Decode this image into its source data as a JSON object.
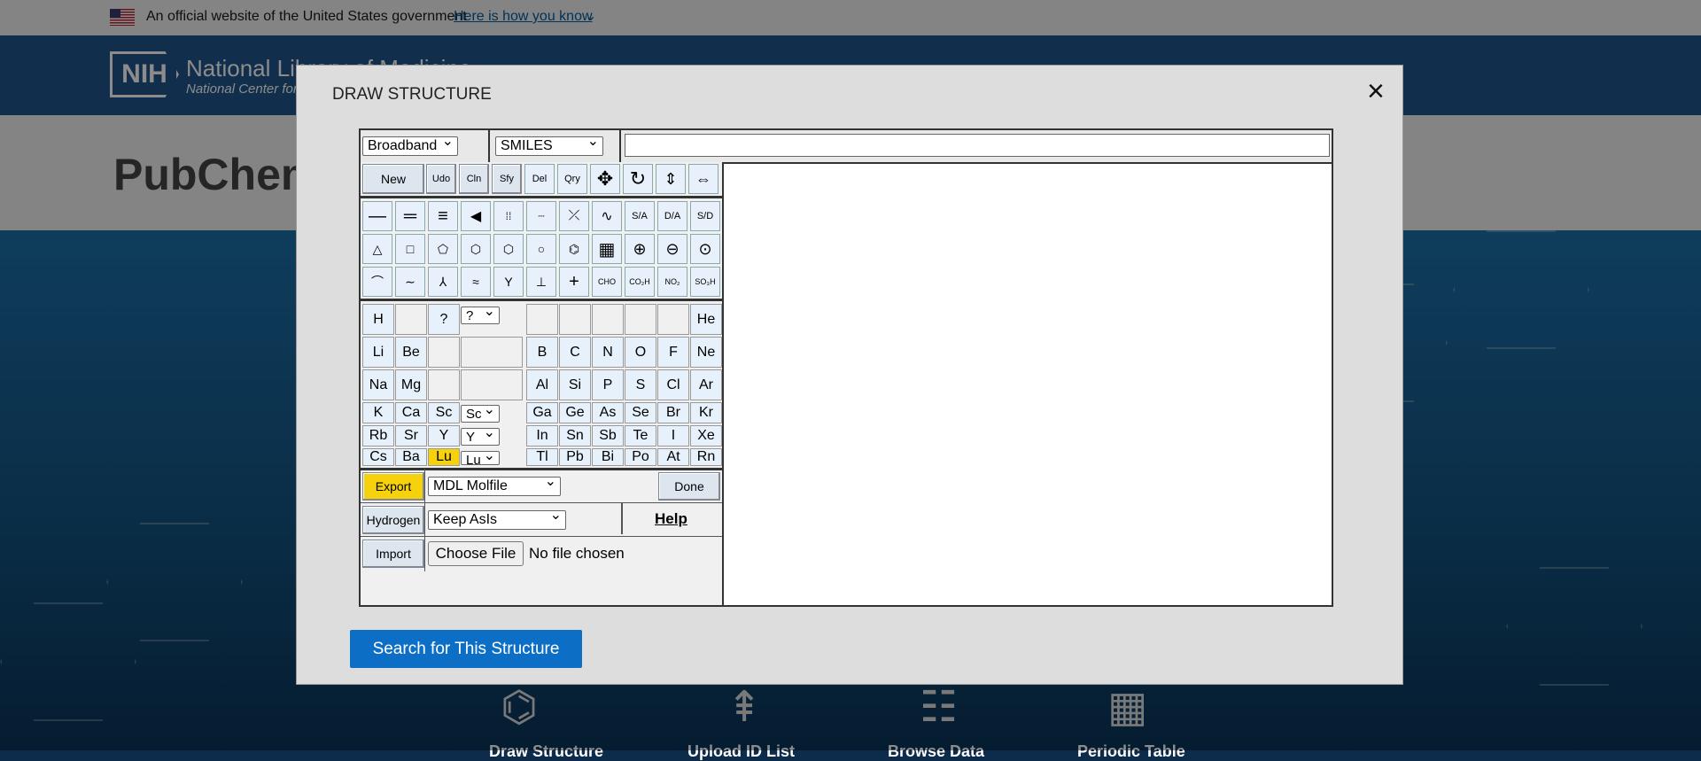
{
  "gov_banner": {
    "text": "An official website of the United States government",
    "link": "Here is how you know"
  },
  "nih": {
    "logo": "NIH",
    "title": "National Library of Medicine",
    "subtitle": "National Center for"
  },
  "pubchem": {
    "logo": "PubChem"
  },
  "tools": [
    "Draw Structure",
    "Upload ID List",
    "Browse Data",
    "Periodic Table"
  ],
  "modal": {
    "title": "DRAW STRUCTURE",
    "close": "×",
    "topbar": {
      "mode": "Broadband",
      "format": "SMILES",
      "smiles_value": ""
    },
    "toolbar_row1": [
      "New",
      "Udo",
      "Cln",
      "Sfy",
      "Del",
      "Qry"
    ],
    "toolbar_row2_labels": [
      "S/A",
      "D/A",
      "S/D"
    ],
    "groups_row": [
      "CHO",
      "CO₂H",
      "NO₂",
      "SO₃H"
    ],
    "periodic": {
      "row1": [
        "H",
        "",
        "?",
        "?"
      ],
      "row1_right": [
        "",
        "",
        "",
        "",
        "",
        "He"
      ],
      "row2": [
        "Li",
        "Be",
        "",
        ""
      ],
      "row2_right": [
        "B",
        "C",
        "N",
        "O",
        "F",
        "Ne"
      ],
      "row3": [
        "Na",
        "Mg",
        "",
        ""
      ],
      "row3_right": [
        "Al",
        "Si",
        "P",
        "S",
        "Cl",
        "Ar"
      ],
      "row4": [
        "K",
        "Ca",
        "Sc",
        "Sc"
      ],
      "row4_right": [
        "Ga",
        "Ge",
        "As",
        "Se",
        "Br",
        "Kr"
      ],
      "row5": [
        "Rb",
        "Sr",
        "Y",
        "Y"
      ],
      "row5_right": [
        "In",
        "Sn",
        "Sb",
        "Te",
        "I",
        "Xe"
      ],
      "row6": [
        "Cs",
        "Ba",
        "Lu",
        "Lu"
      ],
      "row6_right": [
        "Tl",
        "Pb",
        "Bi",
        "Po",
        "At",
        "Rn"
      ]
    },
    "export": {
      "label": "Export",
      "format": "MDL Molfile",
      "done": "Done"
    },
    "hydrogen": {
      "label": "Hydrogen",
      "option": "Keep AsIs",
      "help": "Help"
    },
    "import": {
      "label": "Import",
      "choose": "Choose File",
      "status": "No file chosen"
    },
    "search": "Search for This Structure"
  }
}
